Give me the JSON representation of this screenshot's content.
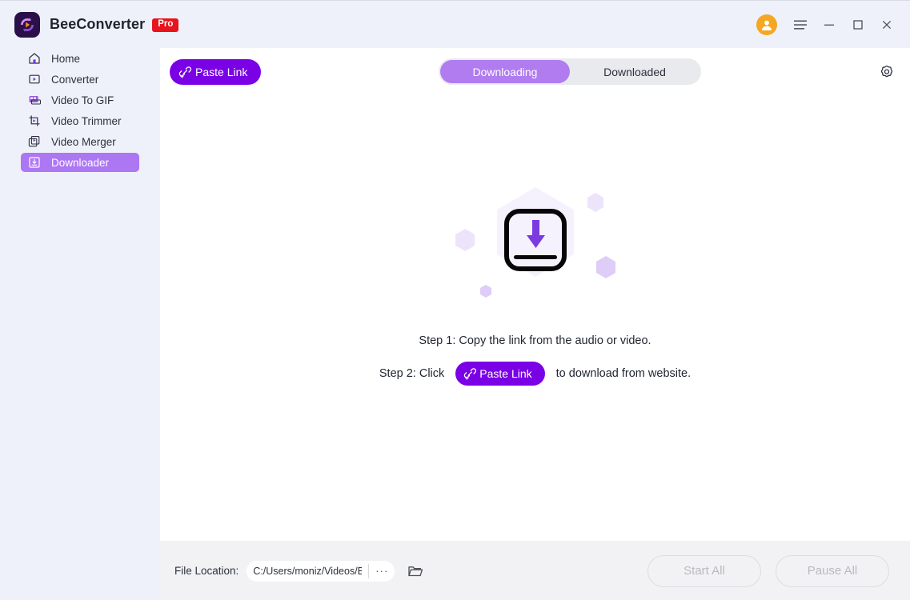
{
  "window": {
    "app_name": "BeeConverter",
    "badge": "Pro",
    "logo_icon": "beeconverter-logo-icon",
    "controls": {
      "account": "account-avatar-icon",
      "menu": "hamburger-menu-icon",
      "minimize": "minimize-icon",
      "maximize": "maximize-icon",
      "close": "close-icon"
    }
  },
  "sidebar": {
    "items": [
      {
        "label": "Home",
        "icon": "home-icon",
        "active": false
      },
      {
        "label": "Converter",
        "icon": "converter-icon",
        "active": false
      },
      {
        "label": "Video To GIF",
        "icon": "video-to-gif-icon",
        "active": false
      },
      {
        "label": "Video Trimmer",
        "icon": "video-trimmer-icon",
        "active": false
      },
      {
        "label": "Video Merger",
        "icon": "video-merger-icon",
        "active": false
      },
      {
        "label": "Downloader",
        "icon": "downloader-icon",
        "active": true
      }
    ]
  },
  "toolbar": {
    "paste_link_label": "Paste Link",
    "paste_link_icon": "link-plus-icon",
    "settings_icon": "gear-icon",
    "tabs": [
      {
        "label": "Downloading",
        "active": true
      },
      {
        "label": "Downloaded",
        "active": false
      }
    ]
  },
  "empty_state": {
    "illustration_icon": "download-box-illustration",
    "step1": "Step 1: Copy the link from the audio or video.",
    "step2_prefix": "Step 2: Click",
    "step2_button": "Paste Link",
    "step2_suffix": "to download from website."
  },
  "bottom_bar": {
    "file_location_label": "File Location:",
    "file_location_value": "C:/Users/moniz/Videos/B",
    "browse_dots_label": "···",
    "folder_icon": "open-folder-icon",
    "start_all_label": "Start All",
    "pause_all_label": "Pause All"
  },
  "colors": {
    "accent_purple": "#7a00e6",
    "light_purple": "#b07cf0",
    "sidebar_bg": "#eef1fa",
    "panel_bg": "#ffffff",
    "bottom_bg": "#f2f2f4",
    "pro_red": "#e8141b",
    "avatar_orange": "#f5a623"
  }
}
